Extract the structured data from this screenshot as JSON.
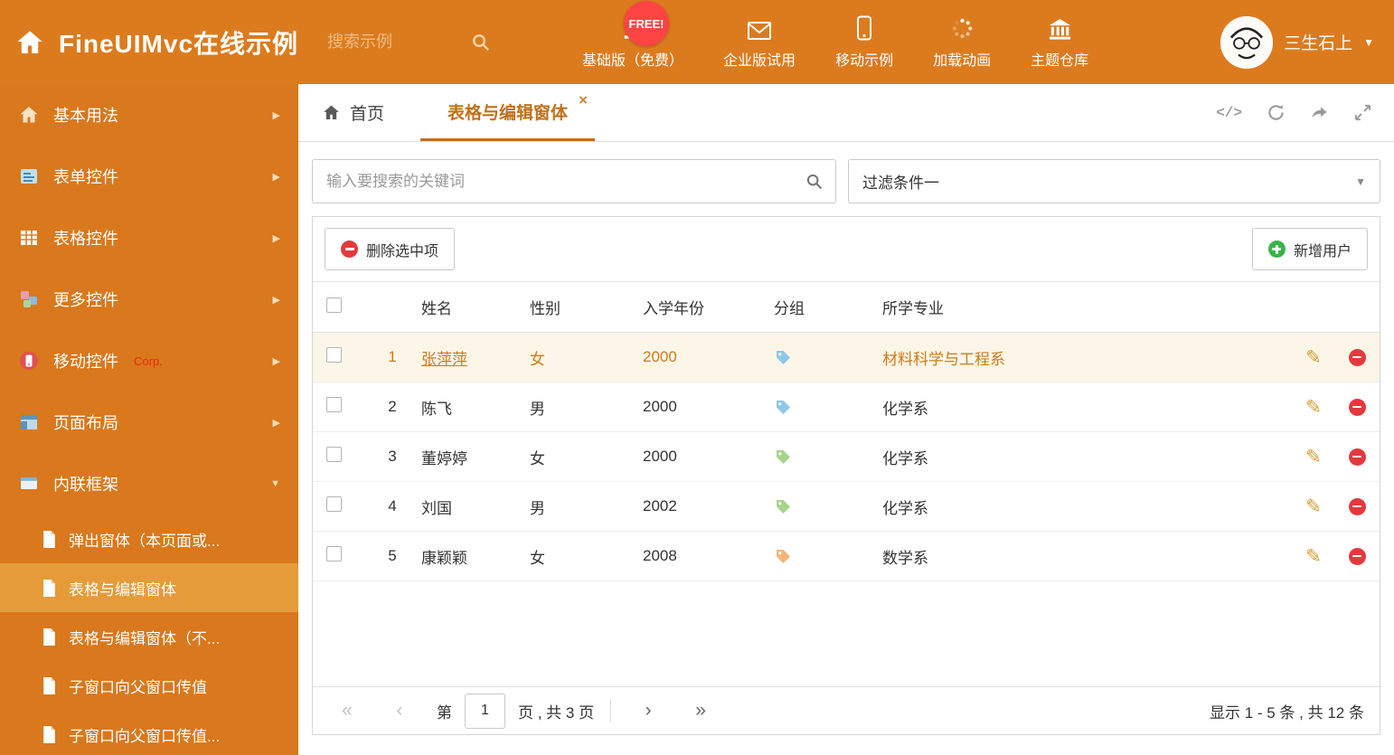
{
  "colors": {
    "header_bg": "#dc7b1e",
    "sidebar_bg": "#d9781c",
    "sidebar_active_bg": "#e59b3a",
    "accent": "#c0701c",
    "selected_row_bg": "#fcf6e8",
    "selected_row_text": "#cd7a1a",
    "free_badge_bg": "#ff4444",
    "delete_red": "#e4393c",
    "add_green": "#39b54a"
  },
  "icons": {
    "close": "×",
    "chevron_right": "▶",
    "chevron_down": "▼",
    "caret_down": "▼",
    "pencil": "✎",
    "pg_first": "«",
    "pg_prev": "‹",
    "pg_next": "›",
    "pg_last": "»",
    "code": "</>"
  },
  "header": {
    "title": "FineUIMvc在线示例",
    "search_placeholder": "搜索示例",
    "free_badge": "FREE!",
    "nav": [
      {
        "label": "基础版（免费）",
        "icon": "download-icon"
      },
      {
        "label": "企业版试用",
        "icon": "envelope-icon"
      },
      {
        "label": "移动示例",
        "icon": "mobile-icon"
      },
      {
        "label": "加载动画",
        "icon": "spinner-icon"
      },
      {
        "label": "主题仓库",
        "icon": "bank-icon"
      }
    ],
    "user": {
      "name": "三生石上"
    }
  },
  "sidebar": {
    "items": [
      {
        "label": "基本用法",
        "icon": "home-icon"
      },
      {
        "label": "表单控件",
        "icon": "form-icon"
      },
      {
        "label": "表格控件",
        "icon": "table-icon"
      },
      {
        "label": "更多控件",
        "icon": "widgets-icon"
      },
      {
        "label": "移动控件",
        "badge": "Corp.",
        "icon": "mobile-icon"
      },
      {
        "label": "页面布局",
        "icon": "layout-icon"
      },
      {
        "label": "内联框架",
        "icon": "frame-icon",
        "expanded": true
      }
    ],
    "subitems": [
      {
        "label": "弹出窗体（本页面或..."
      },
      {
        "label": "表格与编辑窗体",
        "active": true
      },
      {
        "label": "表格与编辑窗体（不..."
      },
      {
        "label": "子窗口向父窗口传值"
      },
      {
        "label": "子窗口向父窗口传值..."
      }
    ]
  },
  "tabs": [
    {
      "label": "首页",
      "icon": "home-icon"
    },
    {
      "label": "表格与编辑窗体",
      "active": true,
      "closable": true
    }
  ],
  "filter": {
    "search_placeholder": "输入要搜索的关键词",
    "dropdown_value": "过滤条件一"
  },
  "toolbar": {
    "delete_label": "删除选中项",
    "add_label": "新增用户"
  },
  "table": {
    "columns": [
      "姓名",
      "性别",
      "入学年份",
      "分组",
      "所学专业"
    ],
    "rows": [
      {
        "num": "1",
        "name": "张萍萍",
        "gender": "女",
        "year": "2000",
        "tag_color": "#8fc7e8",
        "major": "材料科学与工程系",
        "selected": true
      },
      {
        "num": "2",
        "name": "陈飞",
        "gender": "男",
        "year": "2000",
        "tag_color": "#8fc7e8",
        "major": "化学系"
      },
      {
        "num": "3",
        "name": "董婷婷",
        "gender": "女",
        "year": "2000",
        "tag_color": "#a6d48e",
        "major": "化学系"
      },
      {
        "num": "4",
        "name": "刘国",
        "gender": "男",
        "year": "2002",
        "tag_color": "#a6d48e",
        "major": "化学系"
      },
      {
        "num": "5",
        "name": "康颖颖",
        "gender": "女",
        "year": "2008",
        "tag_color": "#f2b678",
        "major": "数学系"
      }
    ]
  },
  "pagination": {
    "prefix": "第",
    "current_page": "1",
    "suffix": "页 , 共 3 页",
    "summary": "显示 1 - 5 条 , 共 12 条"
  }
}
